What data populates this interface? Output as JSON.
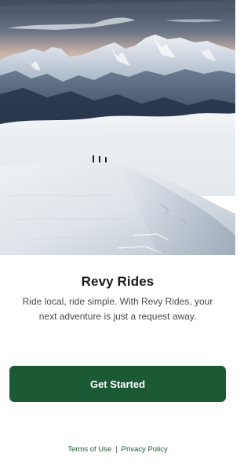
{
  "hero": {
    "icon": "mountain-landscape-photo"
  },
  "app": {
    "title": "Revy Rides",
    "subtitle": "Ride local, ride simple. With Revy Rides, your next adventure is just a request away."
  },
  "actions": {
    "get_started_label": "Get Started"
  },
  "footer": {
    "terms_label": "Terms of Use",
    "separator": "|",
    "privacy_label": "Privacy Policy"
  },
  "colors": {
    "brand_green": "#1c5a35",
    "title_text": "#1a1a1a",
    "body_text": "#4a4a4a"
  }
}
